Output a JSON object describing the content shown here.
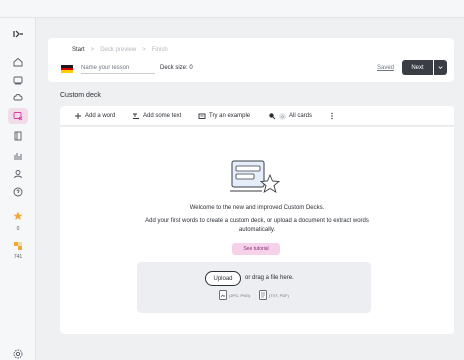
{
  "breadcrumb": {
    "step1": "Start",
    "step2": "Deck preview",
    "step3": "Finish",
    "separator": ">"
  },
  "lesson": {
    "placeholder": "Name your lesson",
    "deck_size": "Deck size: 0"
  },
  "header_actions": {
    "saved": "Saved",
    "next": "Next"
  },
  "section_title": "Custom deck",
  "toolbar": {
    "add_word": "Add a word",
    "add_text": "Add some text",
    "try_example": "Try an example",
    "cards_badge": "0",
    "all_cards": "All cards"
  },
  "empty_state": {
    "welcome": "Welcome to the new and improved Custom Decks.",
    "subtext": "Add your first words to create a custom deck, or upload a document to extract words automatically.",
    "tutorial": "See tutorial"
  },
  "upload": {
    "button": "Upload",
    "drag_text": "or drag a file here.",
    "image_types": "(JPG, PNG)",
    "doc_types": "(TXT, PDF)"
  },
  "sidebar": {
    "streak_count": "0",
    "points_count": "741"
  },
  "colors": {
    "accent": "#d63ba0",
    "dark": "#3a3d44",
    "tutorial_bg": "#f5d2ea",
    "streak": "#f2a93b"
  }
}
